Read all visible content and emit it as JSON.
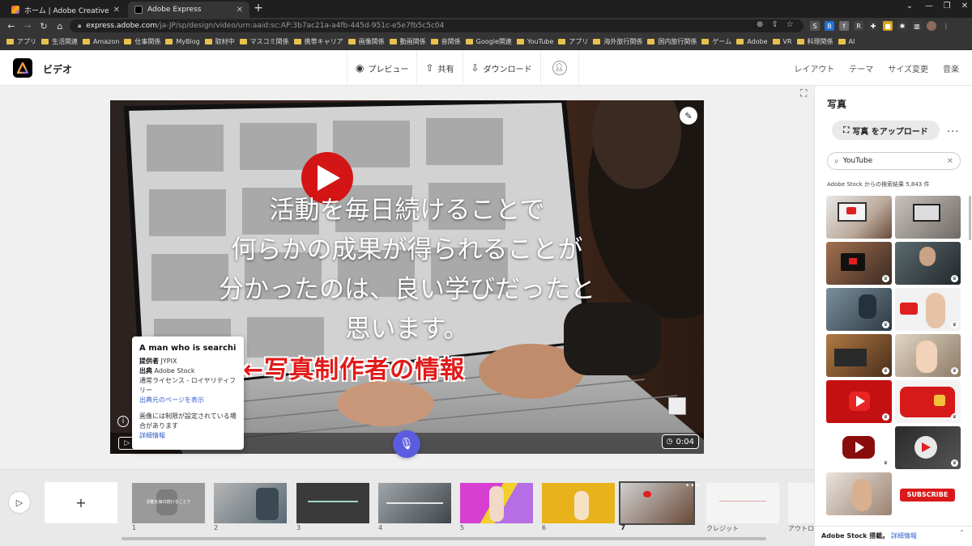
{
  "browser": {
    "tabs": [
      {
        "title": "ホーム | Adobe Creative Cloud",
        "close": "✕"
      },
      {
        "title": "Adobe Express",
        "close": "✕"
      }
    ],
    "new_tab": "+",
    "url_host": "express.adobe.com",
    "url_path": "/ja-JP/sp/design/video/urn:aaid:sc:AP:3b7ac21a-a4fb-445d-951c-e5e7fb5c5c04",
    "bookmarks": [
      "アプリ",
      "生活関連",
      "Amazon",
      "仕事関係",
      "MyBlog",
      "取材中",
      "マスコミ関係",
      "携帯キャリア",
      "画像関係",
      "動画関係",
      "音関係",
      "Google関連",
      "YouTube",
      "アプリ",
      "海外旅行関係",
      "国内旅行関係",
      "ゲーム",
      "Adobe",
      "VR",
      "料理関係",
      "AI"
    ],
    "window_controls": [
      "⌄",
      "—",
      "❐",
      "✕"
    ]
  },
  "header": {
    "doc_title": "ビデオ",
    "actions": [
      {
        "label": "プレビュー"
      },
      {
        "label": "共有"
      },
      {
        "label": "ダウンロード"
      }
    ],
    "right_menu": [
      "レイアウト",
      "テーマ",
      "サイズ変更",
      "音楽"
    ]
  },
  "canvas": {
    "slide_text": [
      "活動を毎日続けることで",
      "何らかの成果が得られることが",
      "分かったのは、良い学びだったと",
      "思います。"
    ],
    "timecode": "0:04",
    "annotation": "←写真制作者の情報"
  },
  "tooltip": {
    "title": "A man who is searchin...",
    "provider_label": "提供者",
    "provider_value": "JYPIX",
    "source_label": "出典",
    "source_value": "Adobe Stock",
    "license": "通常ライセンス - ロイヤリティフリー",
    "source_link": "出典元のページを表示",
    "restriction": "画像には制限が設定されている場合があります",
    "detail_link": "詳細情報"
  },
  "panel": {
    "title": "写真",
    "upload_label": "写真 をアップロード",
    "more": "...",
    "search_value": "YouTube",
    "result_label": "Adobe Stock からの検索結果 5,843 件",
    "footer_text": "Adobe Stock 搭載。",
    "footer_link": "詳細情報",
    "subscribe_text": "SUBSCRIBE"
  },
  "timeline": {
    "add": "+",
    "scenes": [
      {
        "num": "1"
      },
      {
        "num": "2"
      },
      {
        "num": "3"
      },
      {
        "num": "4"
      },
      {
        "num": "5"
      },
      {
        "num": "6"
      },
      {
        "num": "7"
      },
      {
        "num": "クレジット"
      },
      {
        "num": "アウトロ"
      }
    ],
    "scene1_text": "活動を毎日続けることで"
  },
  "colors": {
    "accent": "#5c5ce0",
    "annotation": "#e11a1a",
    "link": "#3b63c9"
  }
}
